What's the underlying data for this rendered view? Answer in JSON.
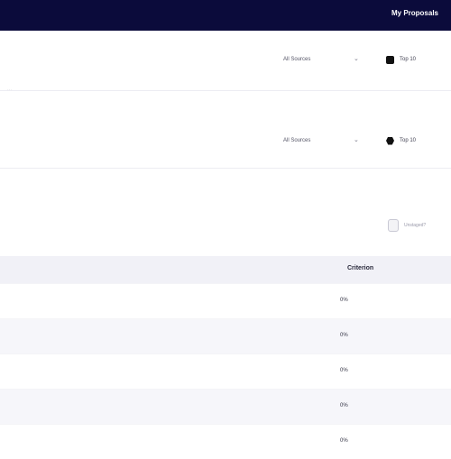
{
  "header": {
    "title": "My Proposals"
  },
  "filters": [
    {
      "dropdown_label": "All Sources",
      "chevron": "chevron-down-icon",
      "pill_label": "Top 10"
    },
    {
      "dropdown_label": "All Sources",
      "chevron": "chevron-down-icon",
      "pill_label": "Top 10"
    }
  ],
  "faint_text": "...",
  "checkbox": {
    "label": "Unstaged?",
    "checked": false
  },
  "table": {
    "columns": [
      "Criterion"
    ],
    "rows": [
      {
        "value": "0%"
      },
      {
        "value": "0%"
      },
      {
        "value": "0%"
      },
      {
        "value": "0%"
      },
      {
        "value": "0%"
      }
    ]
  },
  "colors": {
    "topbar": "#0b0b3b",
    "header_bg": "#f1f1f7",
    "alt_row": "#f6f6fa"
  }
}
